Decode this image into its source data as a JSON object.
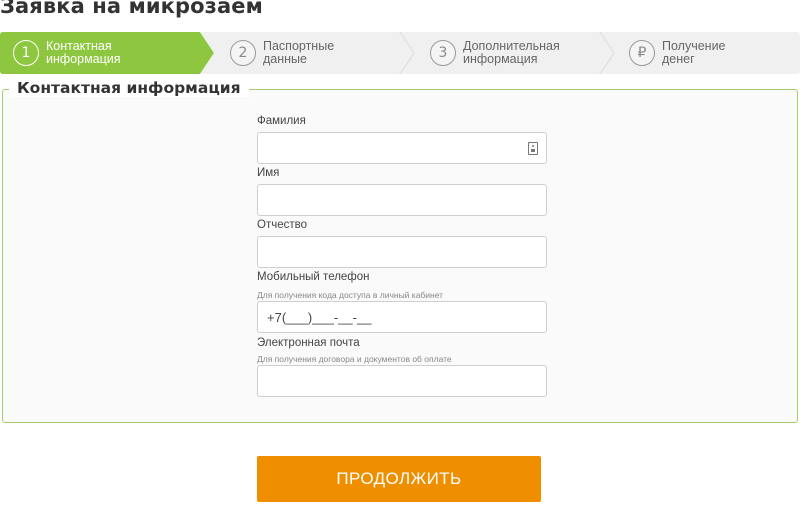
{
  "page": {
    "title": "Заявка на микрозаем"
  },
  "stepper": {
    "active_color": "#8dc63f",
    "inactive_color": "#f0f0f0",
    "steps": [
      {
        "number": "1",
        "label": "Контактная\nинформация",
        "active": true
      },
      {
        "number": "2",
        "label": "Паспортные\nданные",
        "active": false
      },
      {
        "number": "3",
        "label": "Дополнительная\nинформация",
        "active": false
      },
      {
        "number": "₽",
        "label": "Получение\nденег",
        "active": false
      }
    ]
  },
  "form": {
    "section_title": "Контактная информация",
    "border_color": "#a6cc6a",
    "fields": {
      "last_name": {
        "label": "Фамилия",
        "value": ""
      },
      "first_name": {
        "label": "Имя",
        "value": ""
      },
      "middle_name": {
        "label": "Отчество",
        "value": ""
      },
      "phone": {
        "label": "Мобильный телефон",
        "hint": "Для получения кода доступа в личный кабинет",
        "value": "+7(___)___-__-__"
      },
      "email": {
        "label": "Электронная почта",
        "hint": "Для получения договора и документов об оплате",
        "value": ""
      }
    },
    "submit_label": "ПРОДОЛЖИТЬ",
    "submit_color": "#ef8f00"
  }
}
